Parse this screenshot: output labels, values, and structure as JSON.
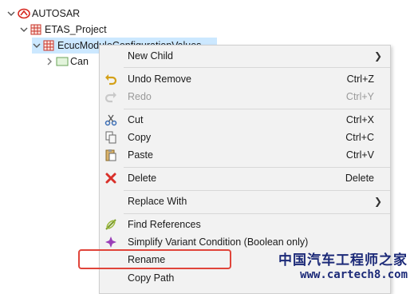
{
  "tree": {
    "items": [
      {
        "label": "AUTOSAR",
        "expanded": true,
        "icon": "autosar-logo-icon"
      },
      {
        "label": "ETAS_Project",
        "expanded": true,
        "icon": "grid-package-icon"
      },
      {
        "label": "EcucModuleConfigurationValues",
        "expanded": true,
        "icon": "grid-package-icon",
        "selected": true
      },
      {
        "label": "Can",
        "expanded": false,
        "icon": "container-icon"
      }
    ]
  },
  "context_menu": {
    "items": [
      {
        "label": "New Child",
        "accel": "",
        "submenu": true,
        "icon": ""
      },
      {
        "label": "Undo Remove",
        "accel": "Ctrl+Z",
        "icon": "undo-icon"
      },
      {
        "label": "Redo",
        "accel": "Ctrl+Y",
        "icon": "redo-icon",
        "disabled": true
      },
      {
        "label": "Cut",
        "accel": "Ctrl+X",
        "icon": "scissors-icon"
      },
      {
        "label": "Copy",
        "accel": "Ctrl+C",
        "icon": "copy-icon"
      },
      {
        "label": "Paste",
        "accel": "Ctrl+V",
        "icon": "paste-icon"
      },
      {
        "label": "Delete",
        "accel": "Delete",
        "icon": "delete-x-icon"
      },
      {
        "label": "Replace With",
        "accel": "",
        "submenu": true,
        "icon": ""
      },
      {
        "label": "Find References",
        "accel": "",
        "icon": "find-references-icon"
      },
      {
        "label": "Simplify Variant Condition (Boolean only)",
        "accel": "",
        "icon": "simplify-variant-icon"
      },
      {
        "label": "Rename",
        "accel": "",
        "icon": ""
      },
      {
        "label": "Copy Path",
        "accel": "",
        "icon": ""
      }
    ]
  },
  "highlight_color": "#e0443a",
  "watermark": {
    "chinese": "中国汽车工程师之家",
    "url": "www.cartech8.com"
  }
}
